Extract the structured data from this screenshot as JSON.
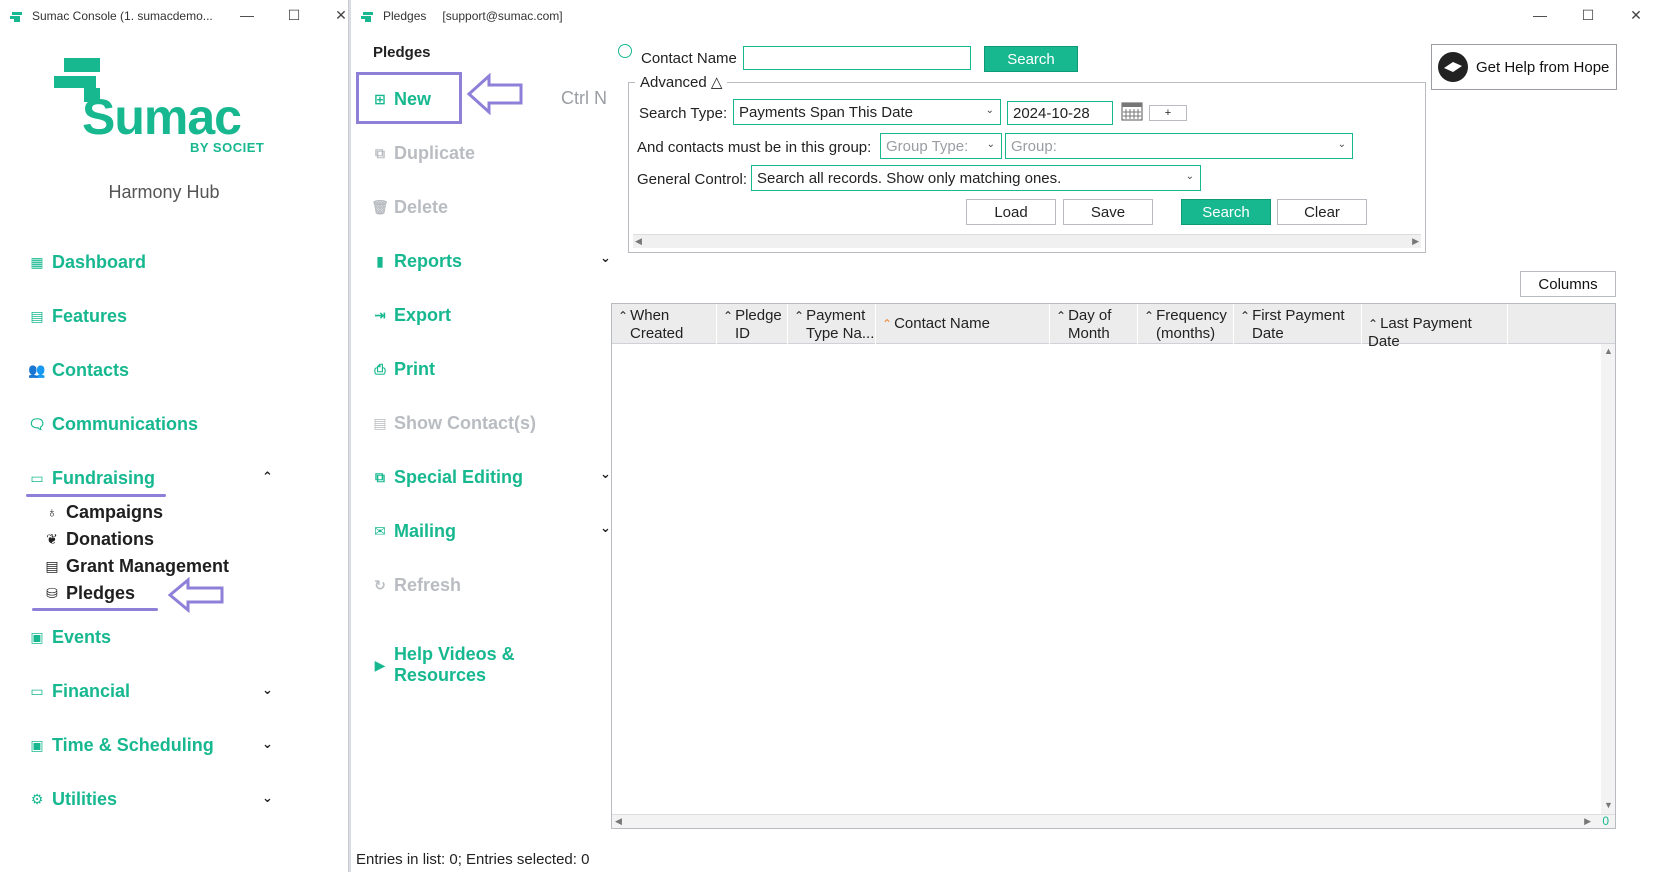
{
  "console": {
    "title": "Sumac Console (1. sumacdemo...",
    "logo_word": "Sumac",
    "logo_by": "BY SOCIET",
    "org_name": "Harmony Hub",
    "nav": [
      {
        "label": "Dashboard",
        "icon": "dashboard-icon"
      },
      {
        "label": "Features",
        "icon": "features-icon"
      },
      {
        "label": "Contacts",
        "icon": "contacts-icon"
      },
      {
        "label": "Communications",
        "icon": "communications-icon"
      },
      {
        "label": "Fundraising",
        "icon": "fundraising-icon"
      },
      {
        "label": "Events",
        "icon": "events-icon"
      },
      {
        "label": "Financial",
        "icon": "financial-icon"
      },
      {
        "label": "Time & Scheduling",
        "icon": "time-scheduling-icon"
      },
      {
        "label": "Utilities",
        "icon": "utilities-icon"
      }
    ],
    "fundraising_sub": [
      {
        "label": "Campaigns",
        "icon": "campaigns-icon"
      },
      {
        "label": "Donations",
        "icon": "donations-icon"
      },
      {
        "label": "Grant Management",
        "icon": "grant-management-icon"
      },
      {
        "label": "Pledges",
        "icon": "pledges-icon"
      }
    ]
  },
  "pledges_window": {
    "title": "Pledges",
    "account": "[support@sumac.com]",
    "column_title": "Pledges",
    "actions": {
      "new": "New",
      "new_shortcut": "Ctrl N",
      "duplicate": "Duplicate",
      "delete": "Delete",
      "reports": "Reports",
      "export": "Export",
      "print": "Print",
      "show_contacts": "Show Contact(s)",
      "special_editing": "Special Editing",
      "mailing": "Mailing",
      "refresh": "Refresh",
      "help_videos": "Help Videos & Resources"
    },
    "search": {
      "contact_name_label": "Contact Name",
      "contact_name_value": "",
      "search_button": "Search",
      "advanced_label": "Advanced",
      "search_type_label": "Search Type:",
      "search_type_value": "Payments Span This Date",
      "date_value": "2024-10-28",
      "plus_button": "+",
      "group_label": "And contacts must be in this group:",
      "group_type_placeholder": "Group Type:",
      "group_placeholder": "Group:",
      "general_control_label": "General Control:",
      "general_control_value": "Search all records. Show only matching ones.",
      "load_button": "Load",
      "save_button": "Save",
      "search_button_2": "Search",
      "clear_button": "Clear"
    },
    "help_button": "Get Help from Hope",
    "columns_button": "Columns",
    "grid_columns": [
      {
        "line1": "When",
        "line2": "Created"
      },
      {
        "line1": "Pledge",
        "line2": "ID"
      },
      {
        "line1": "Payment",
        "line2": "Type Na..."
      },
      {
        "line1": "Contact Name",
        "line2": ""
      },
      {
        "line1": "Day of",
        "line2": "Month"
      },
      {
        "line1": "Frequency",
        "line2": "(months)"
      },
      {
        "line1": "First Payment",
        "line2": "Date"
      },
      {
        "line1": "Last Payment Date",
        "line2": ""
      }
    ],
    "scroll_counter": "0",
    "status": "Entries in list: 0; Entries selected: 0"
  },
  "colors": {
    "accent": "#17b890",
    "highlight": "#8e7fd8",
    "disabled": "#b9bdc2",
    "sort_active": "#e8883a"
  }
}
